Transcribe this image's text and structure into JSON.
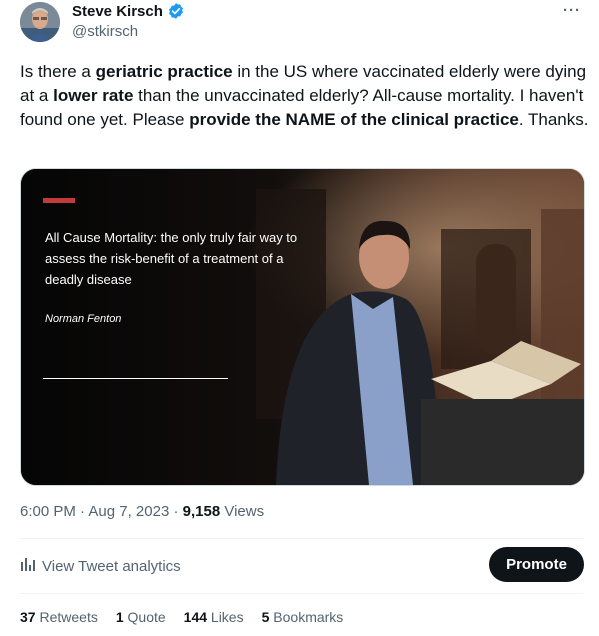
{
  "author": {
    "name": "Steve Kirsch",
    "handle": "@stkirsch"
  },
  "more_label": "···",
  "tweet": {
    "parts": [
      {
        "text": "Is there a ",
        "bold": false
      },
      {
        "text": "geriatric practice",
        "bold": true
      },
      {
        "text": " in the US where vaccinated elderly were dying at a ",
        "bold": false
      },
      {
        "text": "lower rate",
        "bold": true
      },
      {
        "text": " than the unvaccinated elderly? All-cause mortality. I haven't found one yet. Please ",
        "bold": false
      },
      {
        "text": "provide the NAME of the clinical practice",
        "bold": true
      },
      {
        "text": ". Thanks.",
        "bold": false
      }
    ]
  },
  "media": {
    "quote": "All Cause Mortality:  the only truly fair way to assess the risk-benefit of a treatment of a deadly disease",
    "author": "Norman Fenton"
  },
  "meta": {
    "time": "6:00 PM",
    "separator": "·",
    "date": "Aug 7, 2023",
    "views_count": "9,158",
    "views_label": "Views"
  },
  "analytics": {
    "label": "View Tweet analytics"
  },
  "promote_label": "Promote",
  "stats": {
    "retweets_count": "37",
    "retweets_label": "Retweets",
    "quotes_count": "1",
    "quotes_label": "Quote",
    "likes_count": "144",
    "likes_label": "Likes",
    "bookmarks_count": "5",
    "bookmarks_label": "Bookmarks"
  },
  "colors": {
    "brand_verified": "#1d9bf0",
    "text_primary": "#0f1419",
    "text_secondary": "#536471",
    "accent_bar": "#c23b3b"
  }
}
